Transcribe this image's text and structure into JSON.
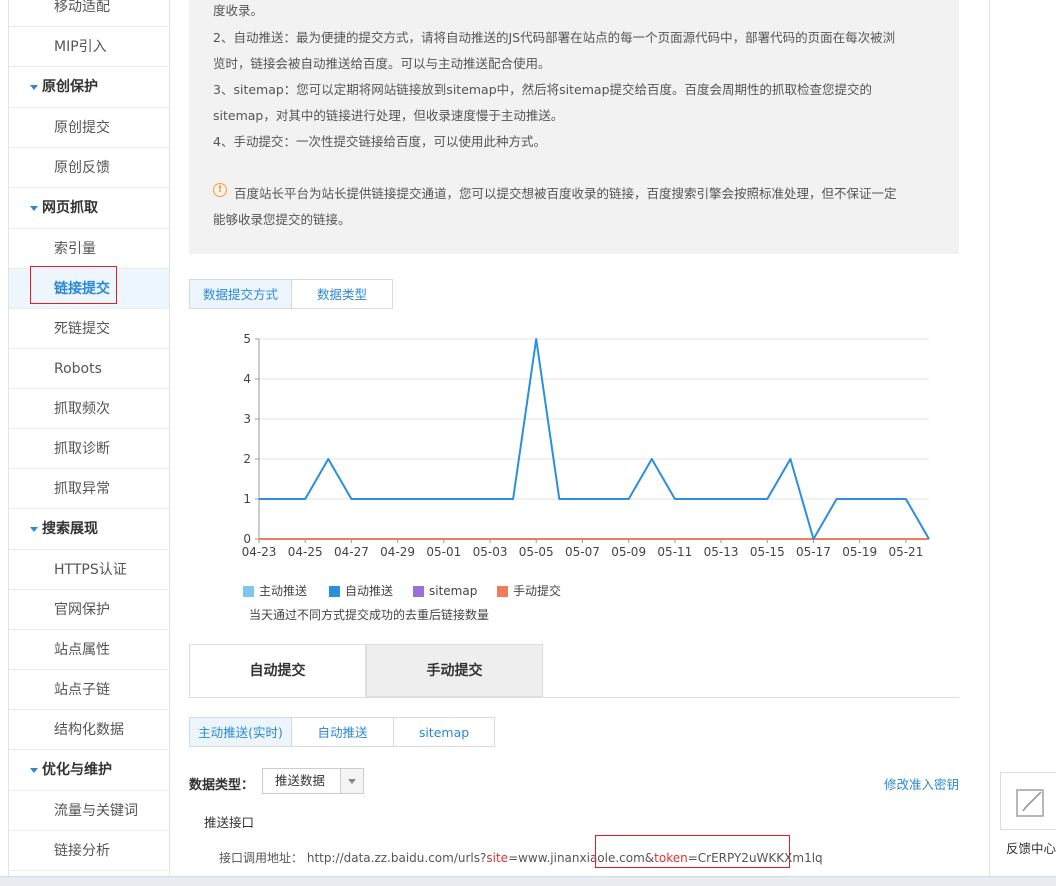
{
  "sidebar": {
    "items": [
      {
        "type": "item",
        "label": "移动适配",
        "first": true
      },
      {
        "type": "item",
        "label": "MIP引入"
      },
      {
        "type": "cat",
        "label": "原创保护"
      },
      {
        "type": "item",
        "label": "原创提交"
      },
      {
        "type": "item",
        "label": "原创反馈"
      },
      {
        "type": "cat",
        "label": "网页抓取"
      },
      {
        "type": "item",
        "label": "索引量"
      },
      {
        "type": "item",
        "label": "链接提交",
        "active": true
      },
      {
        "type": "item",
        "label": "死链提交"
      },
      {
        "type": "item",
        "label": "Robots"
      },
      {
        "type": "item",
        "label": "抓取频次"
      },
      {
        "type": "item",
        "label": "抓取诊断"
      },
      {
        "type": "item",
        "label": "抓取异常"
      },
      {
        "type": "cat",
        "label": "搜索展现"
      },
      {
        "type": "item",
        "label": "HTTPS认证"
      },
      {
        "type": "item",
        "label": "官网保护"
      },
      {
        "type": "item",
        "label": "站点属性"
      },
      {
        "type": "item",
        "label": "站点子链"
      },
      {
        "type": "item",
        "label": "结构化数据"
      },
      {
        "type": "cat",
        "label": "优化与维护"
      },
      {
        "type": "item",
        "label": "流量与关键词"
      },
      {
        "type": "item",
        "label": "链接分析"
      }
    ]
  },
  "info": {
    "line0": "度收录。",
    "line1": "2、自动推送：最为便捷的提交方式，请将自动推送的JS代码部署在站点的每一个页面源代码中，部署代码的页面在每次被浏",
    "line2": "览时，链接会被自动推送给百度。可以与主动推送配合使用。",
    "line3": "3、sitemap：您可以定期将网站链接放到sitemap中，然后将sitemap提交给百度。百度会周期性的抓取检查您提交的",
    "line4": "sitemap，对其中的链接进行处理，但收录速度慢于主动推送。",
    "line5": "4、手动提交：一次性提交链接给百度，可以使用此种方式。",
    "warn_icon": "!",
    "notice1": "百度站长平台为站长提供链接提交通道，您可以提交想被百度收录的链接，百度搜索引擎会按照标准处理，但不保证一定",
    "notice2": "能够收录您提交的链接。"
  },
  "chart_tabs": [
    "数据提交方式",
    "数据类型"
  ],
  "chart_data": {
    "type": "line",
    "x": [
      "04-23",
      "04-24",
      "04-25",
      "04-26",
      "04-27",
      "04-28",
      "04-29",
      "04-30",
      "05-01",
      "05-02",
      "05-03",
      "05-04",
      "05-05",
      "05-06",
      "05-07",
      "05-08",
      "05-09",
      "05-10",
      "05-11",
      "05-12",
      "05-13",
      "05-14",
      "05-15",
      "05-16",
      "05-17",
      "05-18",
      "05-19",
      "05-20",
      "05-21",
      "05-22"
    ],
    "x_tick_labels": [
      "04-23",
      "04-25",
      "04-27",
      "04-29",
      "05-01",
      "05-03",
      "05-05",
      "05-07",
      "05-09",
      "05-11",
      "05-13",
      "05-15",
      "05-17",
      "05-19",
      "05-21"
    ],
    "ylim": [
      0,
      5
    ],
    "yticks": [
      0,
      1,
      2,
      3,
      4,
      5
    ],
    "grid": true,
    "series": [
      {
        "name": "主动推送",
        "color": "#7ec8ed",
        "values": [
          0,
          0,
          0,
          0,
          0,
          0,
          0,
          0,
          0,
          0,
          0,
          0,
          0,
          0,
          0,
          0,
          0,
          0,
          0,
          0,
          0,
          0,
          0,
          0,
          0,
          0,
          0,
          0,
          0,
          0
        ]
      },
      {
        "name": "自动推送",
        "color": "#2a8fde",
        "values": [
          1,
          1,
          1,
          2,
          1,
          1,
          1,
          1,
          1,
          1,
          1,
          1,
          5,
          1,
          1,
          1,
          1,
          2,
          1,
          1,
          1,
          1,
          1,
          2,
          0,
          1,
          1,
          1,
          1,
          0
        ]
      },
      {
        "name": "sitemap",
        "color": "#9b6fd8",
        "values": [
          0,
          0,
          0,
          0,
          0,
          0,
          0,
          0,
          0,
          0,
          0,
          0,
          0,
          0,
          0,
          0,
          0,
          0,
          0,
          0,
          0,
          0,
          0,
          0,
          0,
          0,
          0,
          0,
          0,
          0
        ]
      },
      {
        "name": "手动提交",
        "color": "#f07c5c",
        "values": [
          0,
          0,
          0,
          0,
          0,
          0,
          0,
          0,
          0,
          0,
          0,
          0,
          0,
          0,
          0,
          0,
          0,
          0,
          0,
          0,
          0,
          0,
          0,
          0,
          0,
          0,
          0,
          0,
          0,
          0
        ]
      }
    ],
    "note": "当天通过不同方式提交成功的去重后链接数量"
  },
  "submit_tabs": [
    "自动提交",
    "手动提交"
  ],
  "push_tabs": [
    "主动推送(实时)",
    "自动推送",
    "sitemap"
  ],
  "data_type": {
    "label": "数据类型：",
    "value": "推送数据"
  },
  "modify_link": "修改准入密钥",
  "push_interface": "推送接口",
  "api": {
    "label": "接口调用地址：",
    "prefix": "http://data.zz.baidu.com/urls?",
    "site_key": "site",
    "site_val": "=www.jinanxiaole.com&",
    "token_key": "token",
    "token_val": "=CrERPY2uWKKXm1lq"
  },
  "feedback": {
    "label": "反馈中心",
    "icon": "edit-icon"
  }
}
